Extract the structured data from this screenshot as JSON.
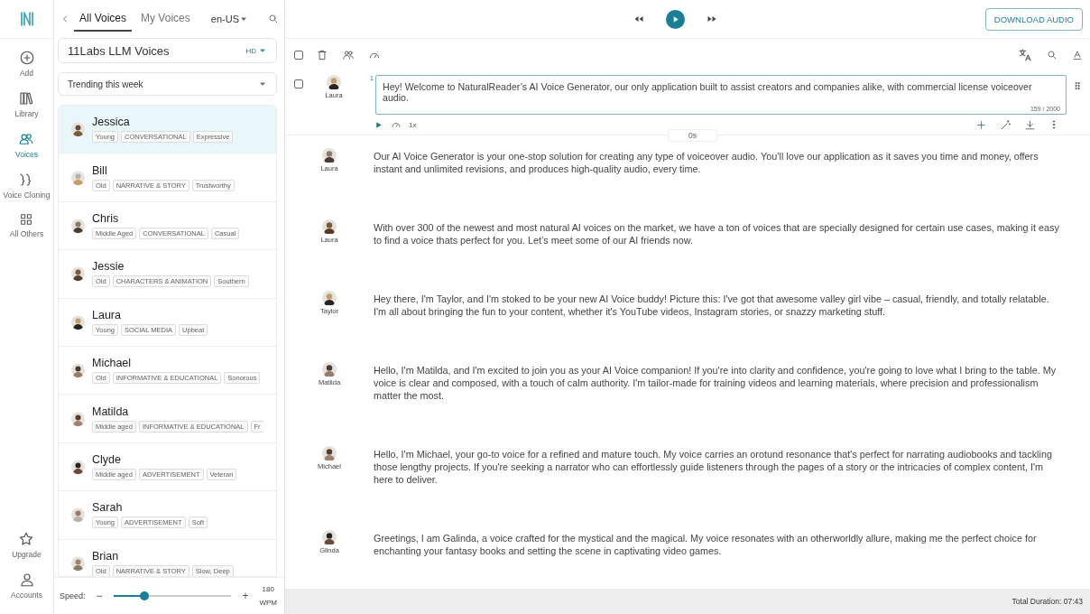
{
  "rail": {
    "items": [
      {
        "label": "Add",
        "kind": "add",
        "selected": false
      },
      {
        "label": "Library",
        "kind": "library",
        "selected": false
      },
      {
        "label": "Voices",
        "kind": "voices",
        "selected": true
      },
      {
        "label": "Voice Cloning",
        "kind": "cloning",
        "selected": false
      },
      {
        "label": "All Others",
        "kind": "grid",
        "selected": false
      }
    ],
    "bottom": [
      {
        "label": "Upgrade",
        "kind": "star"
      },
      {
        "label": "Accounts",
        "kind": "person"
      }
    ]
  },
  "voice_panel": {
    "tabs": [
      {
        "label": "All Voices",
        "selected": true
      },
      {
        "label": "My Voices",
        "selected": false
      }
    ],
    "language": "en-US",
    "provider": "11Labs LLM Voices",
    "quality": "HD",
    "filter": "Trending this week",
    "voices": [
      {
        "name": "Jessica",
        "tags": [
          "Young",
          "CONVERSATIONAL",
          "Expressive"
        ],
        "selected": true
      },
      {
        "name": "Bill",
        "tags": [
          "Old",
          "NARRATIVE & STORY",
          "Trustworthy"
        ],
        "selected": false
      },
      {
        "name": "Chris",
        "tags": [
          "Middle Aged",
          "CONVERSATIONAL",
          "Casual"
        ],
        "selected": false
      },
      {
        "name": "Jessie",
        "tags": [
          "Old",
          "CHARACTERS & ANIMATION",
          "Southern"
        ],
        "selected": false
      },
      {
        "name": "Laura",
        "tags": [
          "Young",
          "SOCIAL MEDIA",
          "Upbeat"
        ],
        "selected": false
      },
      {
        "name": "Michael",
        "tags": [
          "Old",
          "INFORMATIVE & EDUCATIONAL",
          "Sonorous"
        ],
        "selected": false
      },
      {
        "name": "Matilda",
        "tags": [
          "Middle aged",
          "INFORMATIVE & EDUCATIONAL",
          "Fr"
        ],
        "selected": false
      },
      {
        "name": "Clyde",
        "tags": [
          "Middle aged",
          "ADVERTISEMENT",
          "Veteran"
        ],
        "selected": false
      },
      {
        "name": "Sarah",
        "tags": [
          "Young",
          "ADVERTISEMENT",
          "Soft"
        ],
        "selected": false
      },
      {
        "name": "Brian",
        "tags": [
          "Old",
          "NARRATIVE & STORY",
          "Slow, Deep"
        ],
        "selected": false
      }
    ],
    "speed": {
      "label": "Speed:",
      "minus": "−",
      "plus": "+",
      "level": 0.26,
      "value": "180",
      "unit": "WPM"
    }
  },
  "editor": {
    "download": "DOWNLOAD AUDIO",
    "select_all_checked": false,
    "active_block": {
      "index": "1",
      "voice": "Laura",
      "text": "Hey! Welcome to NaturalReader’s AI Voice Generator, our only application built to assist creators and companies alike, with commercial license voiceover audio.",
      "count": "159 / 2000",
      "speed": "1x",
      "duration": "0s",
      "checked": false
    },
    "blocks": [
      {
        "voice": "Laura",
        "text": "Our AI Voice Generator is your one-stop solution for creating any type of voiceover audio. You’ll love our application as it saves you time and money, offers instant and unlimited revisions, and produces high-quality audio, every time."
      },
      {
        "voice": "Laura",
        "text": "With over 300 of the newest and most natural AI voices on the market, we have a ton of voices that are specially designed for certain use cases, making it easy to find a voice thats perfect for you. Let’s meet some of our AI friends now."
      },
      {
        "voice": "Taylor",
        "text": "Hey there, I'm Taylor, and I'm stoked to be your new AI Voice buddy! Picture this: I've got that awesome valley girl vibe – casual, friendly, and totally relatable. I'm all about bringing the fun to your content, whether it's YouTube videos, Instagram stories, or snazzy marketing stuff."
      },
      {
        "voice": "Matilda",
        "text": "Hello, I'm Matilda, and I'm excited to join you as your AI Voice companion! If you're into clarity and confidence, you're going to love what I bring to the table. My voice is clear and composed, with a touch of calm authority. I'm tailor-made for training videos and learning materials, where precision and professionalism matter the most."
      },
      {
        "voice": "Michael",
        "text": "Hello, I'm Michael, your go-to voice for a refined and mature touch. My voice carries an orotund resonance that's perfect for narrating audiobooks and tackling those lengthy projects. If you're seeking a narrator who can effortlessly guide listeners through the pages of a story or the intricacies of complex content, I'm here to deliver."
      },
      {
        "voice": "Glinda",
        "text": "Greetings, I am Galinda, a voice crafted for the mystical and the magical. My voice resonates with an otherworldly allure, making me the perfect choice for enchanting your fantasy books and setting the scene in captivating video games."
      }
    ],
    "total_duration": "Total Duration: 07:43"
  }
}
